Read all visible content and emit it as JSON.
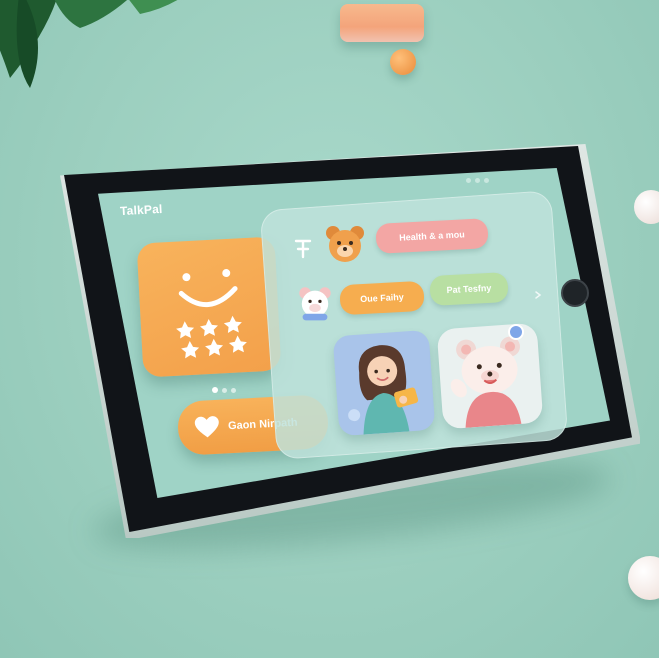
{
  "app": {
    "title": "TalkPal"
  },
  "buttons": {
    "primary_label": "Gaon Nirpath"
  },
  "pills": {
    "pink_label": "Health & a mou",
    "orange_label": "Oue Faihy",
    "green_label": "Pat Tesfny"
  },
  "pager": {
    "count": 3,
    "active_index": 0
  },
  "colors": {
    "background": "#9ccfbf",
    "accent_orange": "#f3a04a",
    "accent_pink": "#f3a6a4",
    "accent_green": "#b8dfa2",
    "tile_blue": "#a9c4ea"
  },
  "icons": {
    "face_card": "smiley-face-icon",
    "cta": "heart-icon",
    "nav_top": "pin-icon",
    "nav_mid": "bear-icon",
    "tile_left": "girl-illustration",
    "tile_right": "bear-waving-illustration"
  }
}
